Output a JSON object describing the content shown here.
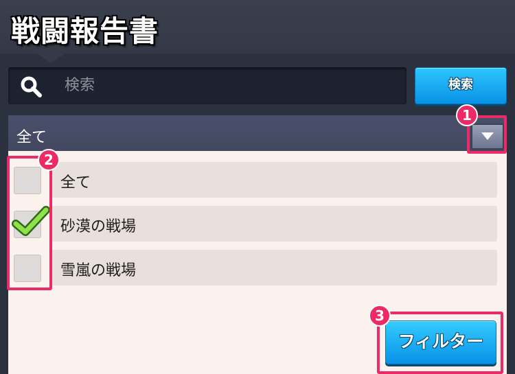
{
  "header": {
    "title": "戦闘報告書"
  },
  "search": {
    "placeholder": "検索",
    "value": "",
    "button_label": "検索"
  },
  "dropdown": {
    "selected": "全て"
  },
  "filters": {
    "options": [
      {
        "label": "全て",
        "checked": false
      },
      {
        "label": "砂漠の戦場",
        "checked": true
      },
      {
        "label": "雪嵐の戦場",
        "checked": false
      }
    ],
    "button_label": "フィルター"
  },
  "annotations": {
    "markers": [
      "1",
      "2",
      "3"
    ]
  },
  "colors": {
    "accent": "#ec2a68",
    "button_blue": "#0892e6",
    "panel_bg": "#fbf2ee"
  }
}
